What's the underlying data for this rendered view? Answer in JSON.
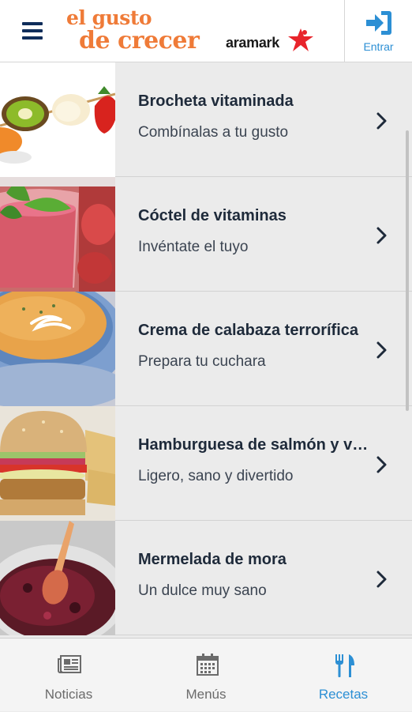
{
  "header": {
    "menu_icon": "hamburger-menu-icon",
    "brand_line1": "el gusto",
    "brand_line2": "de crecer",
    "partner_logo": "aramark",
    "login_label": "Entrar",
    "login_icon": "sign-in-icon",
    "accent_color": "#ef7b38",
    "login_color": "#2c8fd4"
  },
  "recipes": [
    {
      "title": "Brocheta vitaminada",
      "subtitle": "Combínalas a tu gusto"
    },
    {
      "title": "Cóctel de vitaminas",
      "subtitle": "Invéntate el tuyo"
    },
    {
      "title": "Crema de calabaza terrorífica",
      "subtitle": "Prepara tu cuchara"
    },
    {
      "title": "Hamburguesa de salmón y verduras",
      "subtitle": "Ligero, sano y divertido"
    },
    {
      "title": "Mermelada de mora",
      "subtitle": "Un dulce muy sano"
    }
  ],
  "bottom_nav": {
    "items": [
      {
        "label": "Noticias",
        "icon": "newspaper-icon",
        "active": false
      },
      {
        "label": "Menús",
        "icon": "calendar-icon",
        "active": false
      },
      {
        "label": "Recetas",
        "icon": "fork-knife-icon",
        "active": true
      }
    ],
    "active_color": "#2c8fd4",
    "inactive_color": "#6b6b6b"
  }
}
